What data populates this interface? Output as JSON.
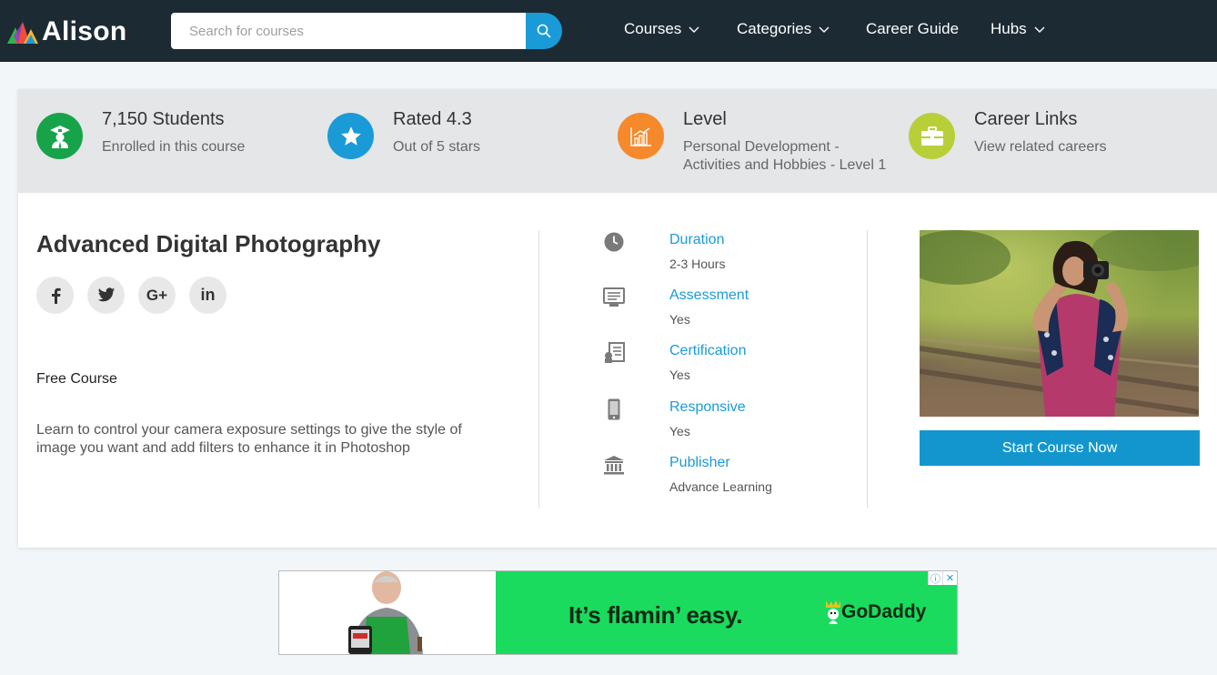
{
  "header": {
    "logo_text": "Alison",
    "search_placeholder": "Search for courses",
    "nav": [
      {
        "label": "Courses",
        "has_dropdown": true
      },
      {
        "label": "Categories",
        "has_dropdown": true
      },
      {
        "label": "Career Guide",
        "has_dropdown": false
      },
      {
        "label": "Hubs",
        "has_dropdown": true
      }
    ]
  },
  "stats": [
    {
      "title": "7,150 Students",
      "sub": "Enrolled in this course",
      "icon": "graduate-icon",
      "color": "#17a34a"
    },
    {
      "title": "Rated 4.3",
      "sub": "Out of 5 stars",
      "icon": "star-icon",
      "color": "#1a9bd7"
    },
    {
      "title": "Level",
      "sub": "Personal Development -",
      "sub2": "Activities and Hobbies - Level 1",
      "icon": "chart-icon",
      "color": "#f5892b"
    },
    {
      "title": "Career Links",
      "sub": "View related careers",
      "icon": "briefcase-icon",
      "color": "#b9cf3a"
    }
  ],
  "course": {
    "title": "Advanced Digital Photography",
    "socials": [
      "f",
      "t",
      "G+",
      "in"
    ],
    "free_label": "Free Course",
    "description": "Learn to control your camera exposure settings to give the style of image you want and add filters to enhance it in Photoshop"
  },
  "info": [
    {
      "label": "Duration",
      "value": "2-3 Hours",
      "icon": "clock-icon"
    },
    {
      "label": "Assessment",
      "value": "Yes",
      "icon": "assessment-icon"
    },
    {
      "label": "Certification",
      "value": "Yes",
      "icon": "certificate-icon"
    },
    {
      "label": "Responsive",
      "value": "Yes",
      "icon": "mobile-icon"
    },
    {
      "label": "Publisher",
      "value": "Advance Learning",
      "icon": "institution-icon"
    }
  ],
  "cta": {
    "label": "Start Course Now"
  },
  "ad": {
    "slogan": "It’s flamin’ easy.",
    "brand": "GoDaddy",
    "info": "ⓘ",
    "close": "✕"
  }
}
